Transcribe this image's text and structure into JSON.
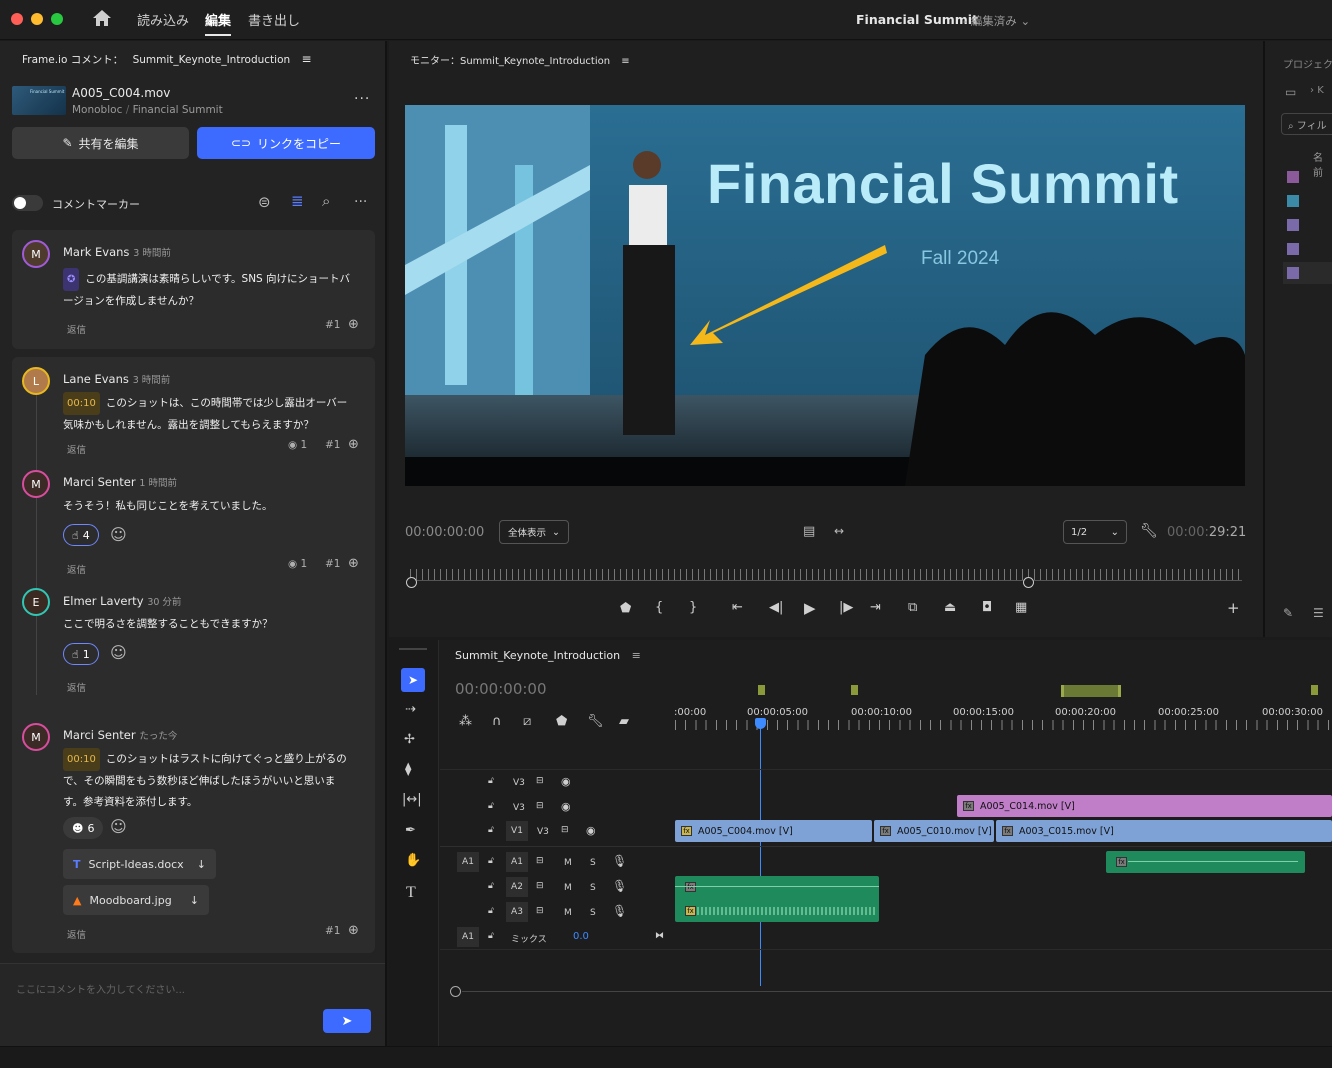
{
  "titlebar": {
    "menu": [
      "読み込み",
      "編集",
      "書き出し"
    ],
    "project_title": "Financial Summit",
    "project_status": "- 編集済み"
  },
  "comments_panel": {
    "header": "Frame.io コメント：",
    "sequence": "Summit_Keynote_Introduction",
    "file_name": "A005_C004.mov",
    "file_path_a": "Monobloc",
    "file_path_sep": "/",
    "file_path_b": "Financial Summit",
    "thumb_text": "Financial Summit",
    "edit_share": "共有を編集",
    "copy_link": "リンクをコピー",
    "marker_toggle": "コメントマーカー",
    "input_placeholder": "ここにコメントを入力してください..."
  },
  "comments": [
    {
      "author": "Mark Evans",
      "time": "3 時間前",
      "text": "この基調講演は素晴らしいです。SNS 向けにショートバージョンを作成しませんか？",
      "reply": "返信",
      "num": "#1"
    },
    {
      "author": "Lane Evans",
      "time": "3 時間前",
      "timecode": "00:10",
      "text": "このショットは、この時間帯では少し露出オーバー気味かもしれません。露出を調整してもらえますか？",
      "reply": "返信",
      "views": "1",
      "num": "#1"
    },
    {
      "author": "Marci Senter",
      "time": "1 時間前",
      "text": "そうそう！私も同じことを考えていました。",
      "reaction": "4",
      "reply": "返信",
      "views": "1",
      "num": "#1"
    },
    {
      "author": "Elmer Laverty",
      "time": "30 分前",
      "text": "ここで明るさを調整することもできますか？",
      "reaction": "1",
      "reply": "返信"
    },
    {
      "author": "Marci Senter",
      "time": "たった今",
      "timecode": "00:10",
      "text": "このショットはラストに向けてぐっと盛り上がるので、その瞬間をもう数秒ほど伸ばしたほうがいいと思います。参考資料を添付します。",
      "reaction": "6",
      "attachments": [
        "Script-Ideas.docx",
        "Moodboard.jpg"
      ],
      "reply": "返信",
      "num": "#1"
    }
  ],
  "monitor": {
    "header": "モニター：Summit_Keynote_Introduction",
    "slide_title": "Financial Summit",
    "slide_sub": "Fall 2024",
    "tc_in": "00:00:00:00",
    "fit": "全体表示",
    "res": "1/2",
    "tc_out_dim": "00:00:",
    "tc_out": "29:21"
  },
  "right_panel": {
    "header": "プロジェク",
    "crumb": "K",
    "filter": "フィル",
    "name_col": "名前"
  },
  "timeline": {
    "seq_name": "Summit_Keynote_Introduction",
    "tc": "00:00:00:00",
    "ruler": [
      ":00:00",
      "00:00:05:00",
      "00:00:10:00",
      "00:00:15:00",
      "00:00:20:00",
      "00:00:25:00",
      "00:00:30:00"
    ],
    "tracks_v": [
      {
        "name": "V3"
      },
      {
        "name": "V3"
      },
      {
        "src": "V1",
        "name": "V3"
      }
    ],
    "tracks_a": [
      {
        "src": "A1",
        "name": "A1",
        "m": "M",
        "s": "S"
      },
      {
        "name": "A2",
        "m": "M",
        "s": "S"
      },
      {
        "name": "A3",
        "m": "M",
        "s": "S"
      }
    ],
    "mix_src": "A1",
    "mix_label": "ミックス",
    "mix_value": "0.0",
    "clips": {
      "v3": "A005_C014.mov [V]",
      "v1a": "A005_C004.mov [V]",
      "v1b": "A005_C010.mov [V]",
      "v1c": "A003_C015.mov [V]"
    }
  },
  "colors": {
    "accent": "#3d6bff",
    "clip_blue": "#7fa2d6",
    "clip_pink": "#c07ec9",
    "clip_green": "#1f8a5c",
    "playhead": "#3d8bff"
  }
}
